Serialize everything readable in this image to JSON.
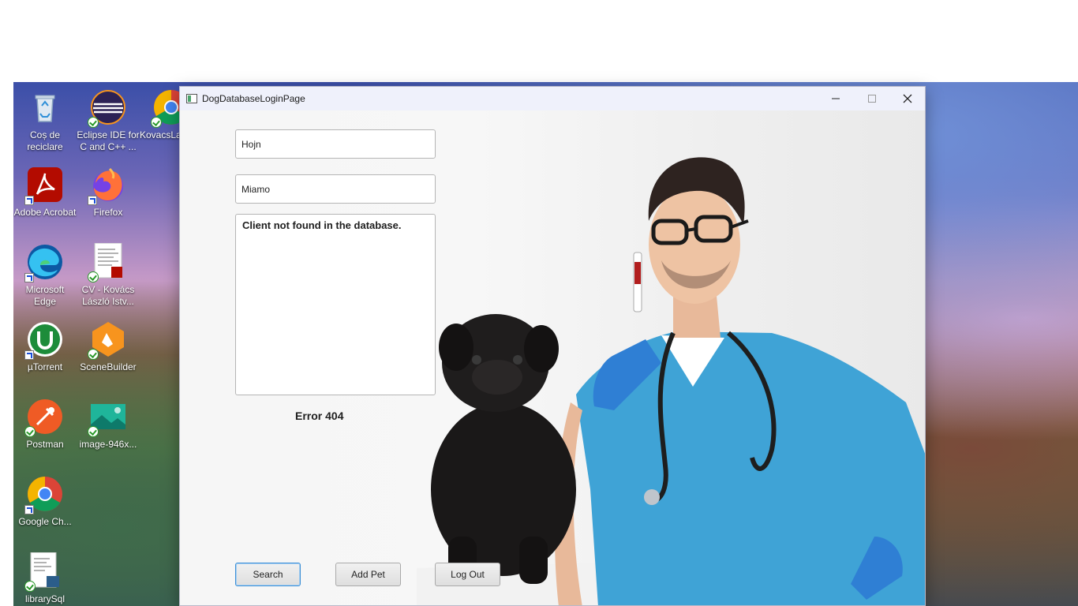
{
  "desktop": {
    "icons": [
      {
        "label": "Coș de reciclare",
        "icon": "recycle-bin-icon"
      },
      {
        "label": "Eclipse IDE for C and C++ ...",
        "icon": "eclipse-icon"
      },
      {
        "label": "KovacsLa",
        "icon": "chrome-icon"
      },
      {
        "label": "Adobe Acrobat",
        "icon": "acrobat-icon"
      },
      {
        "label": "Firefox",
        "icon": "firefox-icon"
      },
      {
        "label": "Microsoft Edge",
        "icon": "edge-icon"
      },
      {
        "label": "CV - Kovács László Istv...",
        "icon": "pdf-document-icon"
      },
      {
        "label": "µTorrent",
        "icon": "utorrent-icon"
      },
      {
        "label": "SceneBuilder",
        "icon": "scenebuilder-icon"
      },
      {
        "label": "Postman",
        "icon": "postman-icon"
      },
      {
        "label": "image-946x...",
        "icon": "image-file-icon"
      },
      {
        "label": "Google Ch...",
        "icon": "chrome-icon"
      },
      {
        "label": "librarySql",
        "icon": "sql-file-icon"
      }
    ]
  },
  "window": {
    "title": "DogDatabaseLoginPage",
    "controls": [
      "minimize-icon",
      "maximize-icon",
      "close-icon"
    ]
  },
  "form": {
    "field1_value": "Hojn",
    "field2_value": "Miamo",
    "result_text": "Client not found in the database.",
    "error_label": "Error 404"
  },
  "buttons": {
    "search": "Search",
    "add_pet": "Add Pet",
    "log_out": "Log Out"
  },
  "colors": {
    "accent": "#3c8fd6",
    "scrubs": "#3fa3d6",
    "gloves": "#2f7fd4"
  }
}
